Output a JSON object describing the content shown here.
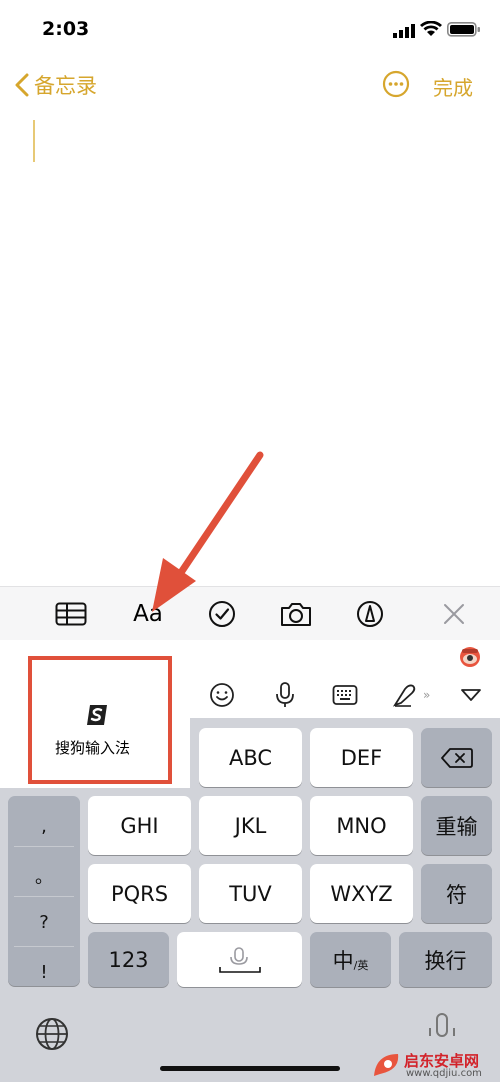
{
  "status": {
    "time": "2:03"
  },
  "nav": {
    "back_label": "备忘录",
    "done_label": "完成"
  },
  "colors": {
    "accent": "#d6a62d",
    "annotation": "#e0503a"
  },
  "toolbar": {
    "format_label": "Aa",
    "icons": [
      "table-icon",
      "format-text",
      "checklist-icon",
      "camera-icon",
      "markup-icon",
      "close-icon"
    ]
  },
  "keyboard": {
    "sogou_label": "搜狗输入法",
    "func_icons": [
      "emoji-icon",
      "microphone-icon",
      "keyboard-icon",
      "handwriting-icon",
      "hide-keyboard-icon"
    ],
    "punct": [
      ",",
      "。",
      "?",
      "!"
    ],
    "rows": [
      [
        "ABC",
        "DEF"
      ],
      [
        "GHI",
        "JKL",
        "MNO",
        "重输"
      ],
      [
        "PQRS",
        "TUV",
        "WXYZ",
        "符"
      ],
      [
        "123",
        "中",
        "换行"
      ]
    ],
    "zh_sub": "/英"
  },
  "watermark": {
    "text": "启东安卓网",
    "url": "www.qdjiu.com"
  }
}
